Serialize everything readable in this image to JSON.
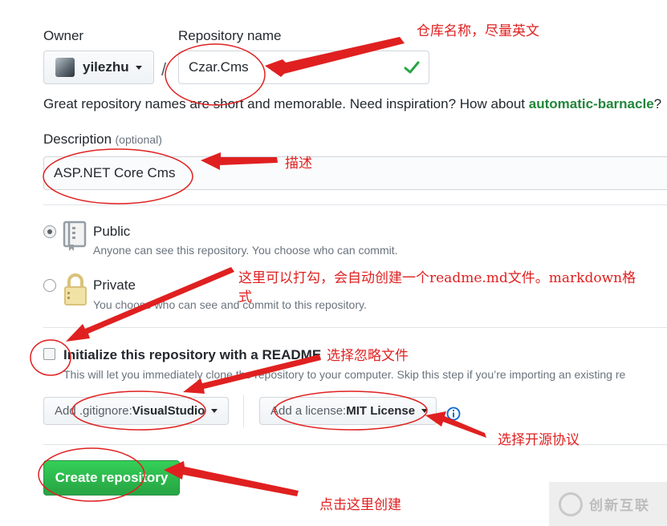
{
  "form": {
    "owner_label": "Owner",
    "owner_value": "yilezhu",
    "separator": "/",
    "repo_name_label": "Repository name",
    "repo_name_value": "Czar.Cms",
    "hint_prefix": "Great repository names are short and memorable. Need inspiration? How about ",
    "hint_suggestion": "automatic-barnacle",
    "hint_suffix": "?",
    "description_label": "Description",
    "description_optional": "(optional)",
    "description_value": "ASP.NET Core Cms",
    "public_label": "Public",
    "public_note": "Anyone can see this repository. You choose who can commit.",
    "private_label": "Private",
    "private_note": "You choose who can see and commit to this repository.",
    "readme_label": "Initialize this repository with a README",
    "readme_note": "This will let you immediately clone the repository to your computer. Skip this step if you’re importing an existing re",
    "gitignore_prefix": "Add .gitignore: ",
    "gitignore_value": "VisualStudio",
    "license_prefix": "Add a license: ",
    "license_value": "MIT License",
    "create_button": "Create repository",
    "visibility_selected": "public",
    "readme_checked": false
  },
  "annotations": {
    "repo_name": "仓库名称，尽量英文",
    "description": "描述",
    "readme_line1": "这里可以打勾，会自动创建一个readme.md文件。markdown格",
    "readme_line2": "式",
    "gitignore": "选择忽略文件",
    "license": "选择开源协议",
    "create": "点击这里创建",
    "color": "#e02020"
  },
  "watermark": {
    "text": "创新互联"
  },
  "colors": {
    "create_button": "#2ea44f",
    "suggestion": "#22863a",
    "annotation": "#e02020"
  }
}
